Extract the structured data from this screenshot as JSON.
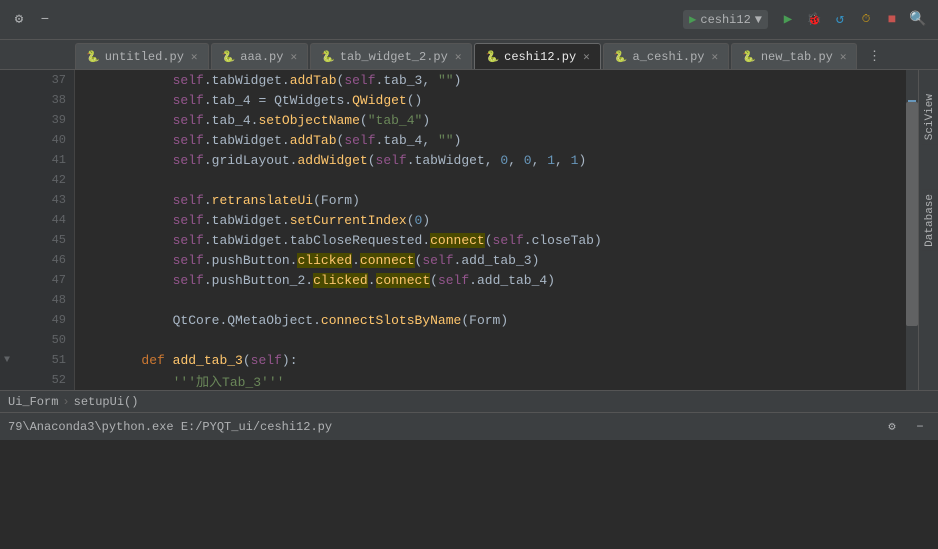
{
  "toolbar": {
    "run_config": "ceshi12",
    "run_config_arrow": "▼",
    "icons": {
      "settings": "⚙",
      "minus": "−",
      "run_green": "▶",
      "run_debug": "🐛",
      "rerun": "↺",
      "coverage": "📊",
      "stop_red": "■",
      "search": "🔍"
    }
  },
  "tabs": [
    {
      "id": "untitled",
      "label": "untitled.py",
      "active": false,
      "closable": true
    },
    {
      "id": "aaa",
      "label": "aaa.py",
      "active": false,
      "closable": true
    },
    {
      "id": "tab_widget_2",
      "label": "tab_widget_2.py",
      "active": false,
      "closable": true
    },
    {
      "id": "ceshi12",
      "label": "ceshi12.py",
      "active": true,
      "closable": true
    },
    {
      "id": "a_ceshi",
      "label": "a_ceshi.py",
      "active": false,
      "closable": true
    },
    {
      "id": "new_tab",
      "label": "new_tab.py",
      "active": false,
      "closable": true
    }
  ],
  "lines": [
    {
      "num": 37,
      "code": "            self.tabWidget.addTab(self.tab_3, \"\")"
    },
    {
      "num": 38,
      "code": "            self.tab_4 = QtWidgets.QWidget()"
    },
    {
      "num": 39,
      "code": "            self.tab_4.setObjectName(\"tab_4\")"
    },
    {
      "num": 40,
      "code": "            self.tabWidget.addTab(self.tab_4, \"\")"
    },
    {
      "num": 41,
      "code": "            self.gridLayout.addWidget(self.tabWidget, 0, 0, 1, 1)"
    },
    {
      "num": 42,
      "code": ""
    },
    {
      "num": 43,
      "code": "            self.retranslateUi(Form)"
    },
    {
      "num": 44,
      "code": "            self.tabWidget.setCurrentIndex(0)"
    },
    {
      "num": 45,
      "code": "            self.tabWidget.tabCloseRequested.connect(self.closeTab)"
    },
    {
      "num": 46,
      "code": "            self.pushButton.clicked.connect(self.add_tab_3)"
    },
    {
      "num": 47,
      "code": "            self.pushButton_2.clicked.connect(self.add_tab_4)"
    },
    {
      "num": 48,
      "code": ""
    },
    {
      "num": 49,
      "code": "            QtCore.QMetaObject.connectSlotsByName(Form)"
    },
    {
      "num": 50,
      "code": ""
    },
    {
      "num": 51,
      "code": "        def add_tab_3(self):"
    },
    {
      "num": 52,
      "code": "            '''加入Tab_3'''"
    }
  ],
  "breadcrumb": {
    "class": "Ui_Form",
    "method": "setupUi()"
  },
  "status_bar": {
    "path": "79\\Anaconda3\\python.exe E:/PYQT_ui/ceshi12.py"
  },
  "right_panel": {
    "label1": "SciView",
    "label2": "Database"
  },
  "scrollbar": {
    "marks": [
      250,
      280,
      310,
      340
    ]
  }
}
